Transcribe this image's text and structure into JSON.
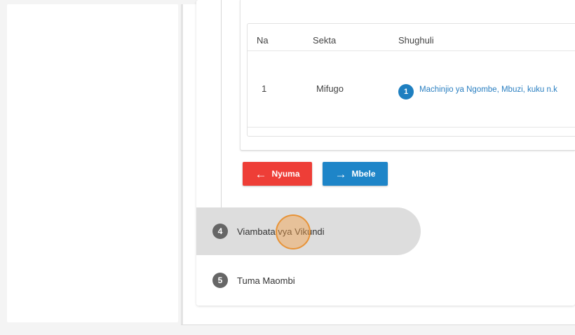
{
  "table": {
    "headers": [
      "Na",
      "Sekta",
      "Shughuli"
    ],
    "rows": [
      {
        "number": "1",
        "sector": "Mifugo",
        "activity_index": "1",
        "activity": "Machinjio ya Ngombe, Mbuzi, kuku n.k"
      }
    ]
  },
  "buttons": {
    "back": {
      "label": "Nyuma",
      "icon": "arrow-left-icon"
    },
    "next": {
      "label": "Mbele",
      "icon": "arrow-right-icon"
    }
  },
  "steps": [
    {
      "number": "4",
      "label": "Viambata vya Vikundi",
      "active": true
    },
    {
      "number": "5",
      "label": "Tuma Maombi",
      "active": false
    }
  ],
  "colors": {
    "back_button": "#ee3e37",
    "next_button": "#1e85c8",
    "link": "#2a7fc1",
    "step_circle": "#666666",
    "active_step_bg": "#dddddd"
  }
}
